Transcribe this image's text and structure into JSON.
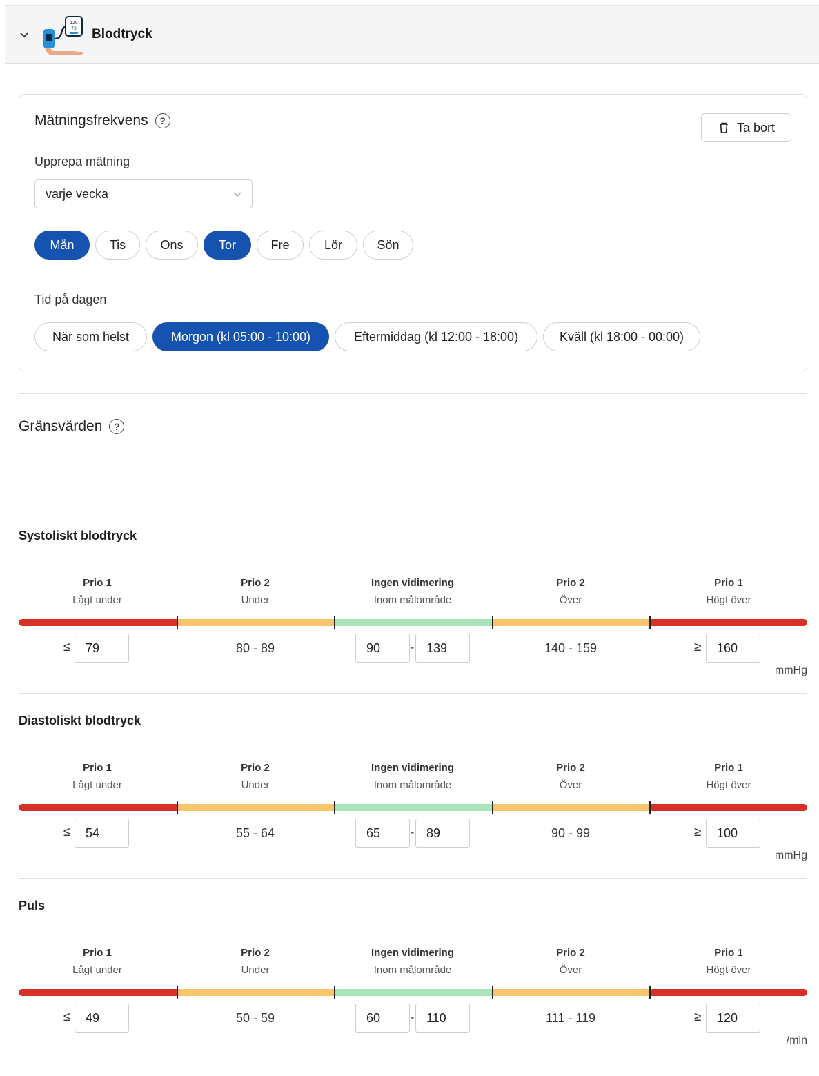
{
  "header": {
    "title": "Blodtryck",
    "device_screen_lines": [
      "129",
      "73"
    ]
  },
  "frequency": {
    "title": "Mätningsfrekvens",
    "delete_label": "Ta bort",
    "repeat_label": "Upprepa mätning",
    "repeat_value": "varje vecka",
    "days": [
      {
        "label": "Mån",
        "active": true
      },
      {
        "label": "Tis",
        "active": false
      },
      {
        "label": "Ons",
        "active": false
      },
      {
        "label": "Tor",
        "active": true
      },
      {
        "label": "Fre",
        "active": false
      },
      {
        "label": "Lör",
        "active": false
      },
      {
        "label": "Sön",
        "active": false
      }
    ],
    "time_label": "Tid på dagen",
    "times": [
      {
        "label": "När som helst",
        "active": false
      },
      {
        "label": "Morgon (kl 05:00 - 10:00)",
        "active": true
      },
      {
        "label": "Eftermiddag (kl 12:00 - 18:00)",
        "active": false
      },
      {
        "label": "Kväll (kl 18:00 - 00:00)",
        "active": false
      }
    ]
  },
  "limits": {
    "title": "Gränsvärden",
    "zones": [
      {
        "prio": "Prio 1",
        "desc": "Lågt under"
      },
      {
        "prio": "Prio 2",
        "desc": "Under"
      },
      {
        "prio": "Ingen vidimering",
        "desc": "Inom målområde"
      },
      {
        "prio": "Prio 2",
        "desc": "Över"
      },
      {
        "prio": "Prio 1",
        "desc": "Högt över"
      }
    ],
    "le_symbol": "≤",
    "ge_symbol": "≥",
    "dash": "-",
    "colors": {
      "prio1": "#d73026",
      "prio2": "#f8c56c",
      "target": "#a8e5b8",
      "accent": "#1653b0"
    },
    "groups": [
      {
        "title": "Systoliskt blodtryck",
        "low_max": "79",
        "under_range": "80 - 89",
        "target_min": "90",
        "target_max": "139",
        "over_range": "140 - 159",
        "high_min": "160",
        "unit": "mmHg"
      },
      {
        "title": "Diastoliskt blodtryck",
        "low_max": "54",
        "under_range": "55 - 64",
        "target_min": "65",
        "target_max": "89",
        "over_range": "90 - 99",
        "high_min": "100",
        "unit": "mmHg"
      },
      {
        "title": "Puls",
        "low_max": "49",
        "under_range": "50 - 59",
        "target_min": "60",
        "target_max": "110",
        "over_range": "111 - 119",
        "high_min": "120",
        "unit": "/min"
      }
    ]
  }
}
